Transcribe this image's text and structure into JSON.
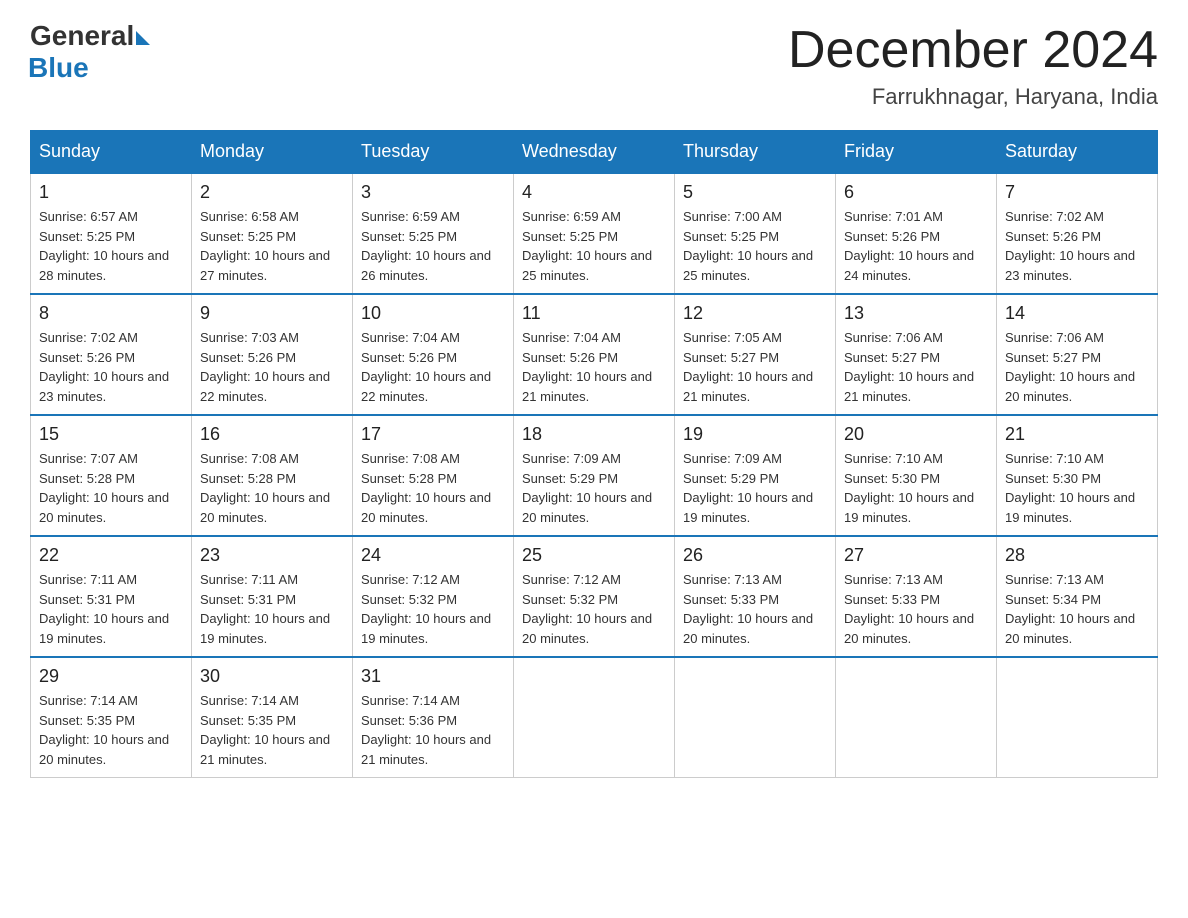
{
  "logo": {
    "general": "General",
    "blue": "Blue"
  },
  "title": "December 2024",
  "subtitle": "Farrukhnagar, Haryana, India",
  "days_of_week": [
    "Sunday",
    "Monday",
    "Tuesday",
    "Wednesday",
    "Thursday",
    "Friday",
    "Saturday"
  ],
  "weeks": [
    [
      {
        "day": "1",
        "sunrise": "6:57 AM",
        "sunset": "5:25 PM",
        "daylight": "10 hours and 28 minutes."
      },
      {
        "day": "2",
        "sunrise": "6:58 AM",
        "sunset": "5:25 PM",
        "daylight": "10 hours and 27 minutes."
      },
      {
        "day": "3",
        "sunrise": "6:59 AM",
        "sunset": "5:25 PM",
        "daylight": "10 hours and 26 minutes."
      },
      {
        "day": "4",
        "sunrise": "6:59 AM",
        "sunset": "5:25 PM",
        "daylight": "10 hours and 25 minutes."
      },
      {
        "day": "5",
        "sunrise": "7:00 AM",
        "sunset": "5:25 PM",
        "daylight": "10 hours and 25 minutes."
      },
      {
        "day": "6",
        "sunrise": "7:01 AM",
        "sunset": "5:26 PM",
        "daylight": "10 hours and 24 minutes."
      },
      {
        "day": "7",
        "sunrise": "7:02 AM",
        "sunset": "5:26 PM",
        "daylight": "10 hours and 23 minutes."
      }
    ],
    [
      {
        "day": "8",
        "sunrise": "7:02 AM",
        "sunset": "5:26 PM",
        "daylight": "10 hours and 23 minutes."
      },
      {
        "day": "9",
        "sunrise": "7:03 AM",
        "sunset": "5:26 PM",
        "daylight": "10 hours and 22 minutes."
      },
      {
        "day": "10",
        "sunrise": "7:04 AM",
        "sunset": "5:26 PM",
        "daylight": "10 hours and 22 minutes."
      },
      {
        "day": "11",
        "sunrise": "7:04 AM",
        "sunset": "5:26 PM",
        "daylight": "10 hours and 21 minutes."
      },
      {
        "day": "12",
        "sunrise": "7:05 AM",
        "sunset": "5:27 PM",
        "daylight": "10 hours and 21 minutes."
      },
      {
        "day": "13",
        "sunrise": "7:06 AM",
        "sunset": "5:27 PM",
        "daylight": "10 hours and 21 minutes."
      },
      {
        "day": "14",
        "sunrise": "7:06 AM",
        "sunset": "5:27 PM",
        "daylight": "10 hours and 20 minutes."
      }
    ],
    [
      {
        "day": "15",
        "sunrise": "7:07 AM",
        "sunset": "5:28 PM",
        "daylight": "10 hours and 20 minutes."
      },
      {
        "day": "16",
        "sunrise": "7:08 AM",
        "sunset": "5:28 PM",
        "daylight": "10 hours and 20 minutes."
      },
      {
        "day": "17",
        "sunrise": "7:08 AM",
        "sunset": "5:28 PM",
        "daylight": "10 hours and 20 minutes."
      },
      {
        "day": "18",
        "sunrise": "7:09 AM",
        "sunset": "5:29 PM",
        "daylight": "10 hours and 20 minutes."
      },
      {
        "day": "19",
        "sunrise": "7:09 AM",
        "sunset": "5:29 PM",
        "daylight": "10 hours and 19 minutes."
      },
      {
        "day": "20",
        "sunrise": "7:10 AM",
        "sunset": "5:30 PM",
        "daylight": "10 hours and 19 minutes."
      },
      {
        "day": "21",
        "sunrise": "7:10 AM",
        "sunset": "5:30 PM",
        "daylight": "10 hours and 19 minutes."
      }
    ],
    [
      {
        "day": "22",
        "sunrise": "7:11 AM",
        "sunset": "5:31 PM",
        "daylight": "10 hours and 19 minutes."
      },
      {
        "day": "23",
        "sunrise": "7:11 AM",
        "sunset": "5:31 PM",
        "daylight": "10 hours and 19 minutes."
      },
      {
        "day": "24",
        "sunrise": "7:12 AM",
        "sunset": "5:32 PM",
        "daylight": "10 hours and 19 minutes."
      },
      {
        "day": "25",
        "sunrise": "7:12 AM",
        "sunset": "5:32 PM",
        "daylight": "10 hours and 20 minutes."
      },
      {
        "day": "26",
        "sunrise": "7:13 AM",
        "sunset": "5:33 PM",
        "daylight": "10 hours and 20 minutes."
      },
      {
        "day": "27",
        "sunrise": "7:13 AM",
        "sunset": "5:33 PM",
        "daylight": "10 hours and 20 minutes."
      },
      {
        "day": "28",
        "sunrise": "7:13 AM",
        "sunset": "5:34 PM",
        "daylight": "10 hours and 20 minutes."
      }
    ],
    [
      {
        "day": "29",
        "sunrise": "7:14 AM",
        "sunset": "5:35 PM",
        "daylight": "10 hours and 20 minutes."
      },
      {
        "day": "30",
        "sunrise": "7:14 AM",
        "sunset": "5:35 PM",
        "daylight": "10 hours and 21 minutes."
      },
      {
        "day": "31",
        "sunrise": "7:14 AM",
        "sunset": "5:36 PM",
        "daylight": "10 hours and 21 minutes."
      },
      null,
      null,
      null,
      null
    ]
  ],
  "labels": {
    "sunrise": "Sunrise:",
    "sunset": "Sunset:",
    "daylight": "Daylight:"
  }
}
